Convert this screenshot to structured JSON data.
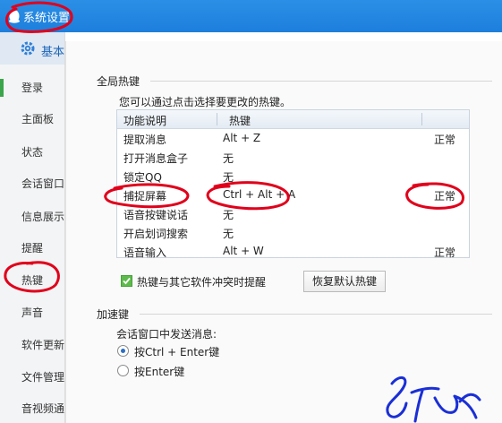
{
  "window": {
    "title": "系统设置"
  },
  "sidebar": {
    "header_label": "基本",
    "items": [
      {
        "label": "登录"
      },
      {
        "label": "主面板"
      },
      {
        "label": "状态"
      },
      {
        "label": "会话窗口"
      },
      {
        "label": "信息展示"
      },
      {
        "label": "提醒"
      },
      {
        "label": "热键"
      },
      {
        "label": "声音"
      },
      {
        "label": "软件更新"
      },
      {
        "label": "文件管理"
      },
      {
        "label": "音视频通"
      }
    ]
  },
  "global_hotkeys": {
    "title": "全局热键",
    "hint": "您可以通过点击选择要更改的热键。",
    "columns": [
      "功能说明",
      "热键"
    ],
    "rows": [
      {
        "function": "提取消息",
        "hotkey": "Alt + Z",
        "status": "正常"
      },
      {
        "function": "打开消息盒子",
        "hotkey": "无",
        "status": ""
      },
      {
        "function": "锁定QQ",
        "hotkey": "无",
        "status": ""
      },
      {
        "function": "捕捉屏幕",
        "hotkey": "Ctrl + Alt + A",
        "status": "正常"
      },
      {
        "function": "语音按键说话",
        "hotkey": "无",
        "status": ""
      },
      {
        "function": "开启划词搜索",
        "hotkey": "无",
        "status": ""
      },
      {
        "function": "语音输入",
        "hotkey": "Alt + W",
        "status": "正常"
      }
    ],
    "conflict_checkbox_label": "热键与其它软件冲突时提醒",
    "conflict_checkbox_checked": true,
    "restore_button_label": "恢复默认热键"
  },
  "accelerator": {
    "title": "加速键",
    "send_label": "会话窗口中发送消息:",
    "options": [
      {
        "label": "按Ctrl + Enter键",
        "selected": true
      },
      {
        "label": "按Enter键",
        "selected": false
      }
    ]
  },
  "colors": {
    "titlebar": "#1d7fdc",
    "annotation_red": "#e0001b",
    "annotation_blue": "#1a2fd6",
    "checkbox_green": "#5dbb4b"
  }
}
